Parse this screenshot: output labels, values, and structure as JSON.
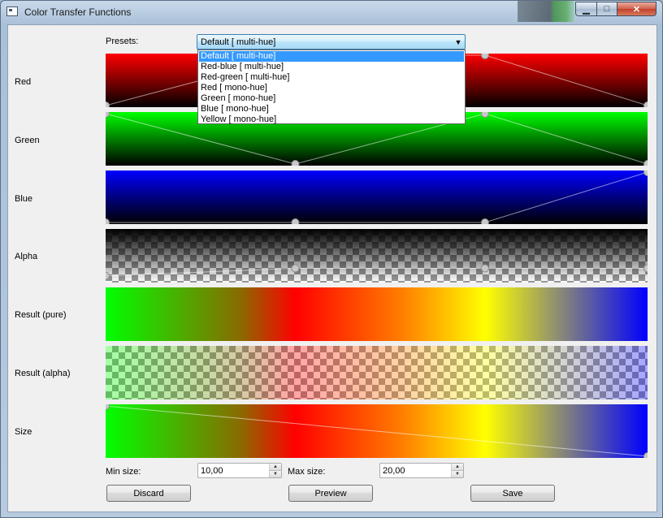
{
  "window": {
    "title": "Color Transfer Functions",
    "min_symbol": "▁",
    "max_symbol": "□",
    "close_symbol": "✕",
    "icon": "app-window-icon"
  },
  "presets": {
    "label": "Presets:",
    "selected": "Default [ multi-hue]",
    "arrow": "▼",
    "options": [
      "Default [ multi-hue]",
      "Red-blue [ multi-hue]",
      "Red-green [ multi-hue]",
      "Red [ mono-hue]",
      "Green [ mono-hue]",
      "Blue [ mono-hue]",
      "Yellow [ mono-hue]"
    ],
    "highlighted_index": 0
  },
  "rows": {
    "red": "Red",
    "green": "Green",
    "blue": "Blue",
    "alpha": "Alpha",
    "result_pure": "Result (pure)",
    "result_alpha": "Result (alpha)",
    "size": "Size"
  },
  "transfer_functions": {
    "red": [
      [
        0,
        0
      ],
      [
        0.35,
        1
      ],
      [
        0.7,
        1
      ],
      [
        1,
        0
      ]
    ],
    "green": [
      [
        0,
        1
      ],
      [
        0.35,
        0
      ],
      [
        0.7,
        1
      ],
      [
        1,
        0
      ]
    ],
    "blue": [
      [
        0,
        0
      ],
      [
        0.35,
        0
      ],
      [
        0.7,
        0
      ],
      [
        1,
        1
      ]
    ],
    "alpha": [
      [
        0,
        0.1
      ],
      [
        0.35,
        0.25
      ],
      [
        0.7,
        0.25
      ],
      [
        1,
        0.25
      ]
    ],
    "size": [
      [
        0,
        1
      ],
      [
        1,
        0
      ]
    ]
  },
  "colors": {
    "result_gradient": [
      "#00ff00",
      "#ff0000",
      "#ffff00",
      "#0000ff"
    ]
  },
  "min_size": {
    "label": "Min size:",
    "value": "10,00"
  },
  "max_size": {
    "label": "Max size:",
    "value": "20,00"
  },
  "spin_up": "▲",
  "spin_down": "▼",
  "buttons": {
    "discard": "Discard",
    "preview": "Preview",
    "save": "Save"
  }
}
